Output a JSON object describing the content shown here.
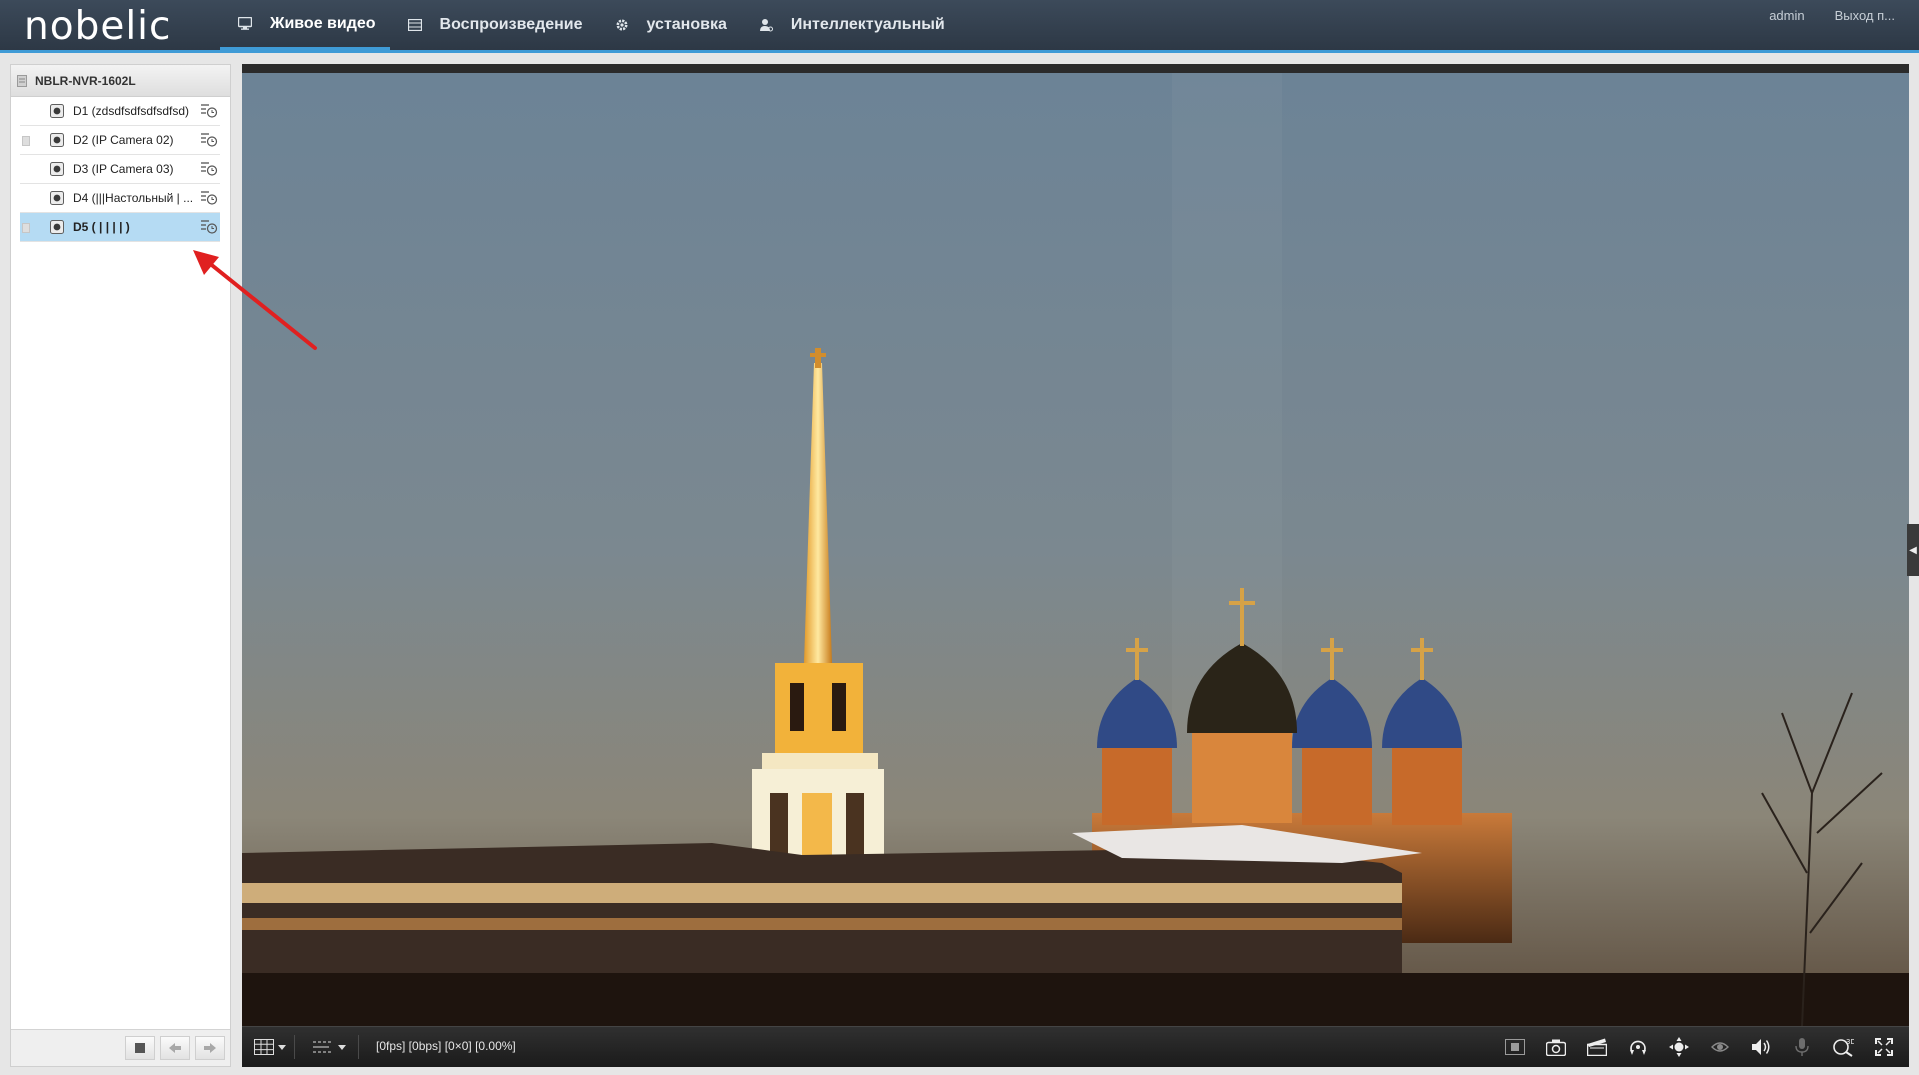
{
  "app": {
    "logo": "nobelic",
    "nav": [
      {
        "label": "Живое видео",
        "icon": "monitor-icon",
        "active": true
      },
      {
        "label": "Воспроизведение",
        "icon": "film-icon",
        "active": false
      },
      {
        "label": "установка",
        "icon": "gear-icon",
        "active": false
      },
      {
        "label": "Интеллектуальный",
        "icon": "person-icon",
        "active": false
      }
    ],
    "user": "admin",
    "logout": "Выход п..."
  },
  "sidebar": {
    "device": "NBLR-NVR-1602L",
    "cameras": [
      {
        "label": "D1 (zdsdfsdfsdfsdfsd)",
        "selected": false
      },
      {
        "label": "D2 (IP Camera 02)",
        "selected": false
      },
      {
        "label": "D3 (IP Camera 03)",
        "selected": false
      },
      {
        "label": "D4 (|||Настольный | ...",
        "selected": false
      },
      {
        "label": "D5 ( | | | | )",
        "selected": true
      }
    ]
  },
  "video": {
    "stream_info": "[0fps] [0bps] [0×0] [0.00%]",
    "toolbar_icons": [
      "stop-all-icon",
      "capture-icon",
      "record-icon",
      "ptz-icon",
      "zoom-icon",
      "3d-icon",
      "volume-icon",
      "microphone-icon",
      "digital-zoom-icon",
      "fullscreen-icon"
    ]
  },
  "colors": {
    "header_bg": "#313d4a",
    "accent": "#3f9bd6",
    "selected_row": "#b5dbf3",
    "annotation_arrow": "#e02020"
  }
}
